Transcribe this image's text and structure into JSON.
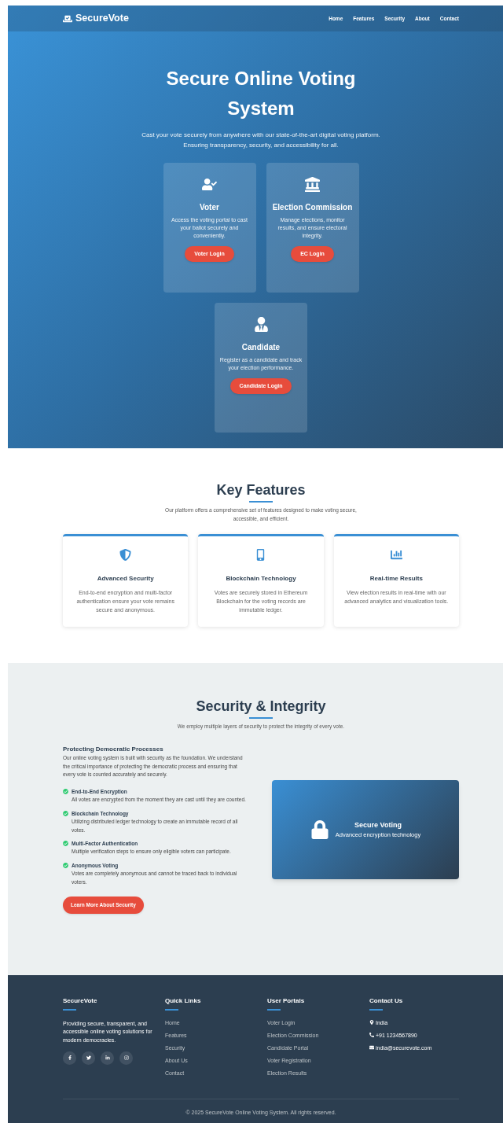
{
  "nav": {
    "brand": "SecureVote",
    "links": [
      "Home",
      "Features",
      "Security",
      "About",
      "Contact"
    ]
  },
  "hero": {
    "title": "Secure Online Voting System",
    "subtitle": "Cast your vote securely from anywhere with our state-of-the-art digital voting platform. Ensuring transparency, security, and accessibility for all.",
    "portals": [
      {
        "kind": "voter",
        "title": "Voter",
        "text": "Access the voting portal to cast your ballot securely and conveniently.",
        "button": "Voter Login"
      },
      {
        "kind": "commission",
        "title": "Election Commission",
        "text": "Manage elections, monitor results, and ensure electoral integrity.",
        "button": "EC Login"
      },
      {
        "kind": "candidate",
        "title": "Candidate",
        "text": "Register as a candidate and track your election performance.",
        "button": "Candidate Login"
      }
    ]
  },
  "features": {
    "title": "Key Features",
    "subtitle": "Our platform offers a comprehensive set of features designed to make voting secure, accessible, and efficient.",
    "items": [
      {
        "kind": "shield",
        "title": "Advanced Security",
        "text": "End-to-end encryption and multi-factor authentication ensure your vote remains secure and anonymous."
      },
      {
        "kind": "mobile",
        "title": "Blockchain Technology",
        "text": "Votes are securely stored in Ethereum Blockchain for the voting records are immutable ledger."
      },
      {
        "kind": "chart",
        "title": "Real-time Results",
        "text": "View election results in real-time with our advanced analytics and visualization tools."
      }
    ]
  },
  "security": {
    "title": "Security & Integrity",
    "subtitle": "We employ multiple layers of security to protect the integrity of every vote.",
    "intro_title": "Protecting Democratic Processes",
    "intro_text": "Our online voting system is built with security as the foundation. We understand the critical importance of protecting the democratic process and ensuring that every vote is counted accurately and securely.",
    "points": [
      {
        "title": "End-to-End Encryption",
        "text": "All votes are encrypted from the moment they are cast until they are counted."
      },
      {
        "title": "Blockchain Technology",
        "text": "Utilizing distributed ledger technology to create an immutable record of all votes."
      },
      {
        "title": "Multi-Factor Authentication",
        "text": "Multiple verification steps to ensure only eligible voters can participate."
      },
      {
        "title": "Anonymous Voting",
        "text": "Votes are completely anonymous and cannot be traced back to individual voters."
      }
    ],
    "button": "Learn More About Security",
    "panel": {
      "title": "Secure Voting",
      "subtitle": "Advanced encryption technology"
    }
  },
  "footer": {
    "about": {
      "title": "SecureVote",
      "text": "Providing secure, transparent, and accessible online voting solutions for modern democracies."
    },
    "social": [
      {
        "kind": "facebook"
      },
      {
        "kind": "twitter"
      },
      {
        "kind": "linkedin"
      },
      {
        "kind": "instagram"
      }
    ],
    "quick_links": {
      "title": "Quick Links",
      "items": [
        "Home",
        "Features",
        "Security",
        "About Us",
        "Contact"
      ]
    },
    "portals": {
      "title": "User Portals",
      "items": [
        "Voter Login",
        "Election Commission",
        "Candidate Portal",
        "Voter Registration",
        "Election Results"
      ]
    },
    "contact": {
      "title": "Contact Us",
      "items": [
        {
          "kind": "location",
          "text": "India"
        },
        {
          "kind": "phone",
          "text": "+91 1234567890"
        },
        {
          "kind": "email",
          "text": "india@securevote.com"
        }
      ]
    },
    "copyright": "© 2025 SecureVote Online Voting System. All rights reserved."
  }
}
